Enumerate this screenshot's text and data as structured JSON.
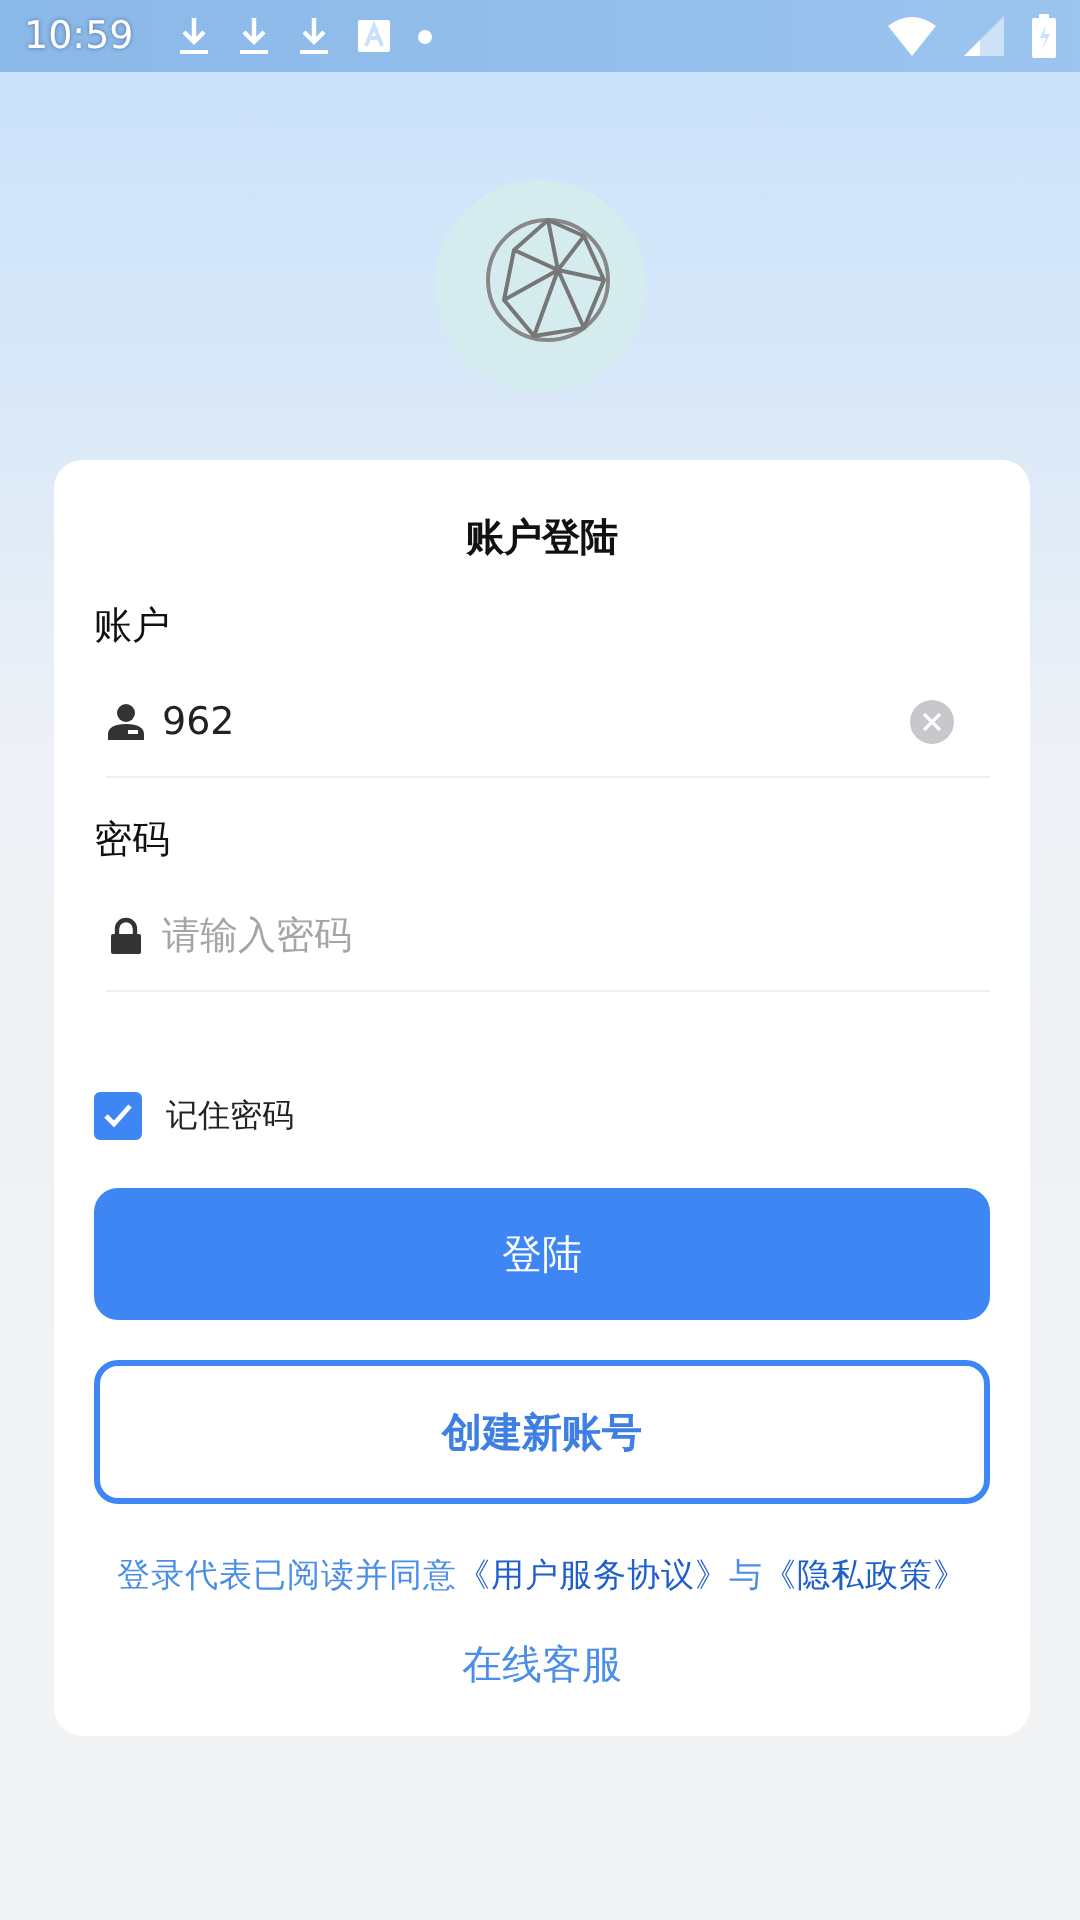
{
  "status_bar": {
    "time": "10:59"
  },
  "form": {
    "title": "账户登陆",
    "fields": [
      {
        "label": "账户",
        "kind": "account",
        "value": "962",
        "clearable": true
      },
      {
        "label": "密码",
        "kind": "password",
        "placeholder": "请输入密码",
        "clearable": false
      }
    ],
    "remember": {
      "label": "记住密码",
      "checked": true
    },
    "login_button": "登陆",
    "register_button": "创建新账号",
    "agreement": [
      {
        "kind": "plain",
        "text": "登录代表已阅读并同意"
      },
      {
        "kind": "link",
        "text": "《用户服务协议》"
      },
      {
        "kind": "plain",
        "text": "与"
      },
      {
        "kind": "link",
        "text": "《隐私政策》"
      }
    ],
    "support_link": "在线客服"
  }
}
